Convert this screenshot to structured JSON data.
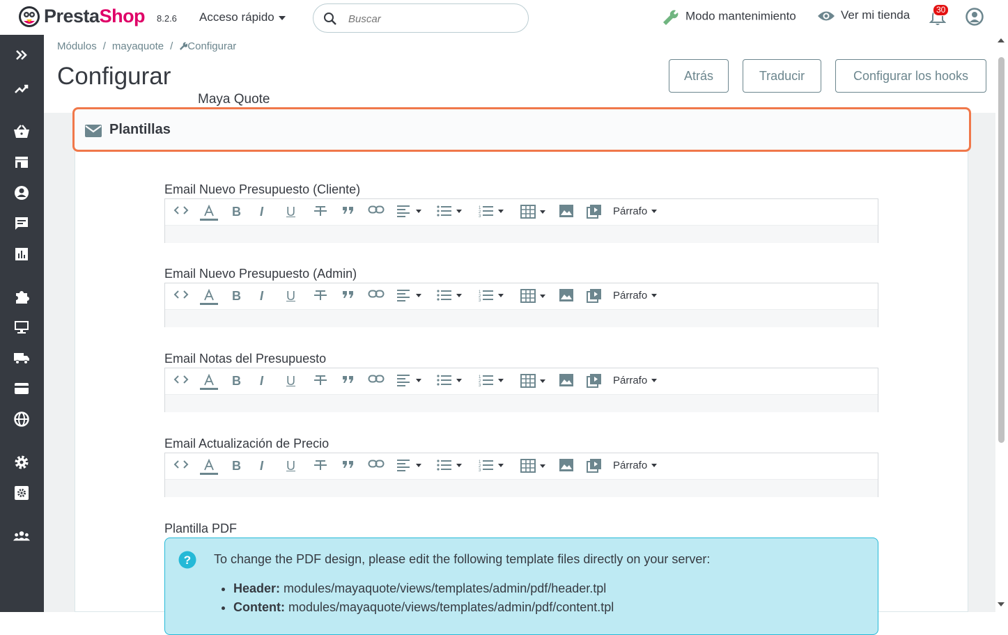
{
  "header": {
    "brand": "PrestaShop",
    "version": "8.2.6",
    "quick_access": "Acceso rápido",
    "search_placeholder": "Buscar",
    "maintenance": "Modo mantenimiento",
    "view_shop": "Ver mi tienda",
    "notifications_count": "30"
  },
  "sidebar": {
    "icons": [
      "expand-icon",
      "dashboard-icon",
      "orders-icon",
      "catalog-icon",
      "customers-icon",
      "messages-icon",
      "stats-icon",
      "modules-icon",
      "design-icon",
      "shipping-icon",
      "payment-icon",
      "international-icon",
      "settings-icon",
      "advanced-settings-icon",
      "team-icon"
    ]
  },
  "breadcrumb": {
    "items": [
      "Módulos",
      "mayaquote",
      "Configurar"
    ],
    "separator": "/"
  },
  "page": {
    "title": "Configurar",
    "subtitle": "Maya Quote"
  },
  "toolbar": {
    "back": "Atrás",
    "translate": "Traducir",
    "hooks": "Configurar los hooks"
  },
  "panel": {
    "title": "Plantillas",
    "fields": [
      {
        "label": "Email Nuevo Presupuesto (Cliente)"
      },
      {
        "label": "Email Nuevo Presupuesto (Admin)"
      },
      {
        "label": "Email Notas del Presupuesto"
      },
      {
        "label": "Email Actualización de Precio"
      }
    ],
    "editor": {
      "paragraph": "Párrafo"
    },
    "pdf": {
      "label": "Plantilla PDF",
      "message": "To change the PDF design, please edit the following template files directly on your server:",
      "files": [
        {
          "name": "Header:",
          "path": "modules/mayaquote/views/templates/admin/pdf/header.tpl"
        },
        {
          "name": "Content:",
          "path": "modules/mayaquote/views/templates/admin/pdf/content.tpl"
        }
      ]
    }
  },
  "colors": {
    "brand": "#df0067",
    "sidebar": "#363a41",
    "highlight": "#f0784a",
    "info_bg": "#beeaf3",
    "info_border": "#25b9d7"
  }
}
